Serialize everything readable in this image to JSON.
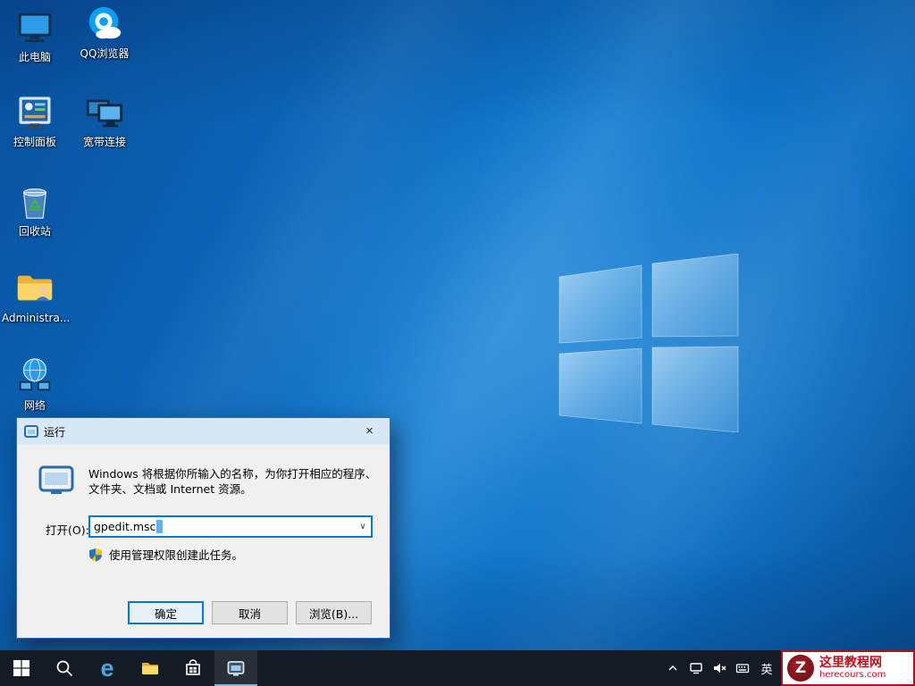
{
  "colors": {
    "accent": "#0078d7",
    "taskbar_bg": "#151b24",
    "dialog_titlebar_bg": "#d7e7f6",
    "watermark_red": "#b5121b"
  },
  "desktop": {
    "icons": [
      {
        "name": "this-pc",
        "label": "此电脑"
      },
      {
        "name": "qq-browser",
        "label": "QQ浏览器"
      },
      {
        "name": "control-panel",
        "label": "控制面板"
      },
      {
        "name": "broadband-connection",
        "label": "宽带连接"
      },
      {
        "name": "recycle-bin",
        "label": "回收站"
      },
      {
        "name": "administrator-folder",
        "label": "Administra..."
      },
      {
        "name": "network",
        "label": "网络"
      }
    ]
  },
  "run_dialog": {
    "title": "运行",
    "close_glyph": "×",
    "description": "Windows 将根据你所输入的名称，为你打开相应的程序、文件夹、文档或 Internet 资源。",
    "open_label": "打开(O):",
    "input_value": "gpedit.msc",
    "dropdown_glyph": "∨",
    "admin_note": "使用管理权限创建此任务。",
    "ok_label": "确定",
    "cancel_label": "取消",
    "browse_label": "浏览(B)..."
  },
  "taskbar": {
    "icons": [
      "start",
      "search",
      "edge",
      "file-explorer",
      "store",
      "run-active"
    ],
    "tray_icons": [
      "tray-expand-chevron",
      "network",
      "volume-muted",
      "ime-keyboard"
    ],
    "edge_glyph": "e",
    "language_indicator": "英"
  },
  "watermark": {
    "logo_letter": "Z",
    "title": "这里教程网",
    "domain": "herecours.com"
  }
}
